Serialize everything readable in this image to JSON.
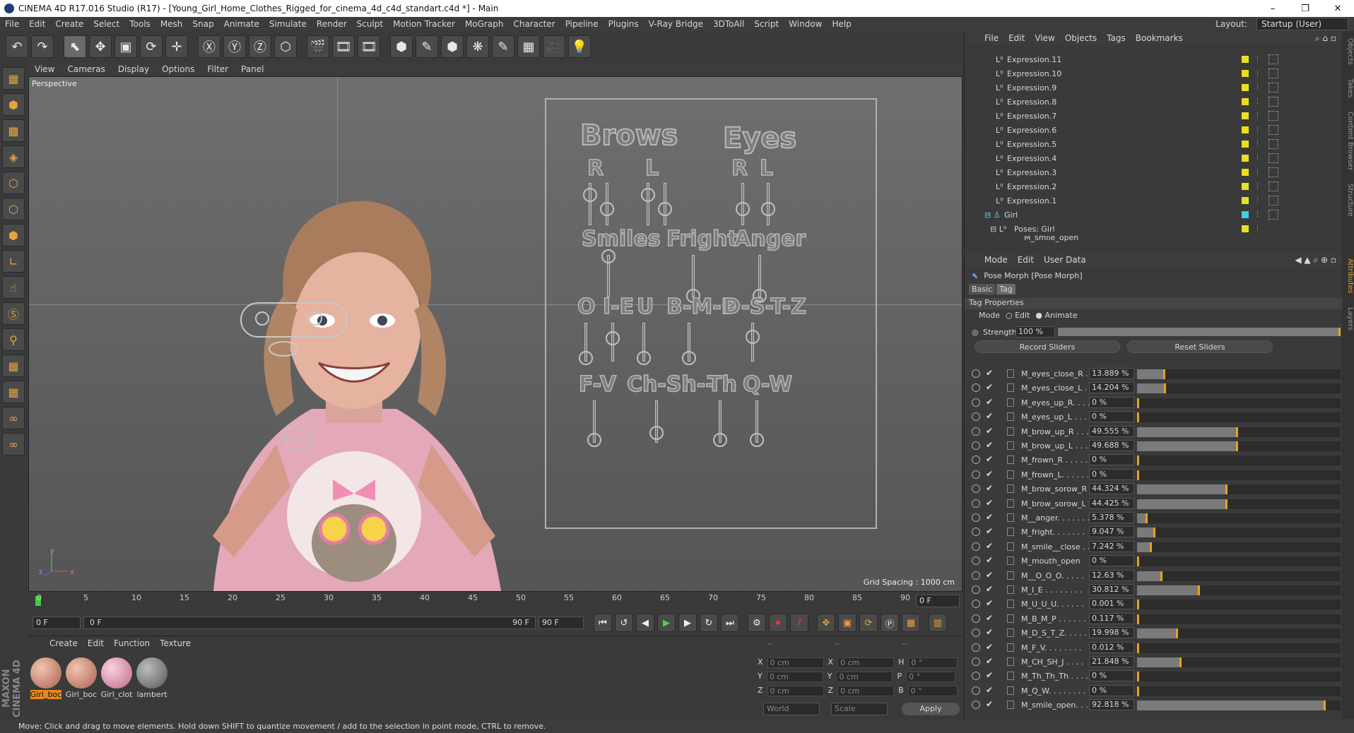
{
  "title": {
    "text": "CINEMA 4D R17.016 Studio (R17) - [Young_Girl_Home_Clothes_Rigged_for_cinema_4d_c4d_standart.c4d *] - Main",
    "min": "–",
    "max": "❐",
    "close": "✕"
  },
  "menubar": {
    "items": [
      "File",
      "Edit",
      "Create",
      "Select",
      "Tools",
      "Mesh",
      "Snap",
      "Animate",
      "Simulate",
      "Render",
      "Sculpt",
      "Motion Tracker",
      "MoGraph",
      "Character",
      "Pipeline",
      "Plugins",
      "V-Ray Bridge",
      "3DToAll",
      "Script",
      "Window",
      "Help"
    ],
    "layout_label": "Layout:",
    "layout_value": "Startup (User)"
  },
  "toolbar": {
    "icons": [
      "↶",
      "↷",
      "⬉",
      "✥",
      "▣",
      "⟳",
      "✛",
      "Ⓧ",
      "Ⓨ",
      "Ⓩ",
      "⬡",
      "🎬",
      "🎞",
      "🎞",
      "⬢",
      "✎",
      "⬢",
      "❋",
      "✎",
      "▦",
      "🎥",
      "💡"
    ]
  },
  "viewport": {
    "menu": [
      "View",
      "Cameras",
      "Display",
      "Options",
      "Filter",
      "Panel"
    ],
    "label": "Perspective",
    "grid_spacing": "Grid Spacing : 1000 cm",
    "axis_y": "y",
    "axis_z": "z",
    "axis_x": "x"
  },
  "rig": {
    "brows": "Brows",
    "eyes": "Eyes",
    "r1": "R",
    "l1": "L",
    "r2": "R",
    "l2": "L",
    "smiles": "Smiles",
    "fright": "Fright",
    "anger": "Anger",
    "o": "O",
    "ie": "I-E",
    "u": "U",
    "bmp": "B-M-P",
    "dstz": "D-S-T-Z",
    "fv": "F-V",
    "chsh": "Ch-Sh--",
    "th": "Th",
    "qw": "Q-W"
  },
  "timeline": {
    "ticks": [
      "0",
      "5",
      "10",
      "15",
      "20",
      "25",
      "30",
      "35",
      "40",
      "45",
      "50",
      "55",
      "60",
      "65",
      "70",
      "75",
      "80",
      "85",
      "90"
    ],
    "end_field": "0 F",
    "start": "0 F",
    "range_start": "0 F",
    "range_end": "90 F",
    "max": "90 F"
  },
  "materials": {
    "menu": [
      "Create",
      "Edit",
      "Function",
      "Texture"
    ],
    "items": [
      "Girl_boc",
      "Girl_boc",
      "Girl_clot",
      "lambert"
    ]
  },
  "coords": {
    "header1": "--",
    "header2": "--",
    "header3": "--",
    "x": "X",
    "y": "Y",
    "z": "Z",
    "x_val": "0 cm",
    "y_val": "0 cm",
    "z_val": "0 cm",
    "x2": "X",
    "y2": "Y",
    "z2": "Z",
    "x2_val": "0 cm",
    "y2_val": "0 cm",
    "z2_val": "0 cm",
    "h": "H",
    "p": "P",
    "b": "B",
    "h_val": "0 °",
    "p_val": "0 °",
    "b_val": "0 °",
    "world": "World",
    "scale": "Scale",
    "apply": "Apply"
  },
  "status": "Move: Click and drag to move elements. Hold down SHIFT to quantize movement / add to the selection in point mode, CTRL to remove.",
  "objmgr": {
    "menu": [
      "File",
      "Edit",
      "View",
      "Objects",
      "Tags",
      "Bookmarks"
    ],
    "rows": [
      "Expression.11",
      "Expression.10",
      "Expression.9",
      "Expression.8",
      "Expression.7",
      "Expression.6",
      "Expression.5",
      "Expression.4",
      "Expression.3",
      "Expression.2",
      "Expression.1",
      "Girl",
      "Poses: Girl",
      "M_smile_open"
    ]
  },
  "attr": {
    "menu": [
      "Mode",
      "Edit",
      "User Data"
    ],
    "title": "Pose Morph [Pose Morph]",
    "tab_basic": "Basic",
    "tab_tag": "Tag",
    "section": "Tag Properties",
    "mode_label": "Mode",
    "mode_edit": "Edit",
    "mode_animate": "Animate",
    "strength_label": "Strength",
    "strength_value": "100 %",
    "record": "Record Sliders",
    "reset": "Reset Sliders",
    "sliders": [
      {
        "name": "M_eyes_close_R . .",
        "value": "13.889 %",
        "pct": 13.889
      },
      {
        "name": "M_eyes_close_L . .",
        "value": "14.204 %",
        "pct": 14.204
      },
      {
        "name": "M_eyes_up_R. . . .",
        "value": "0 %",
        "pct": 0
      },
      {
        "name": "M_eyes_up_L . . . .",
        "value": "0 %",
        "pct": 0
      },
      {
        "name": "M_brow_up_R . . . .",
        "value": "49.555 %",
        "pct": 49.555
      },
      {
        "name": "M_brow_up_L . . . .",
        "value": "49.688 %",
        "pct": 49.688
      },
      {
        "name": "M_frown_R . . . . .",
        "value": "0 %",
        "pct": 0
      },
      {
        "name": "M_frown_L. . . . . .",
        "value": "0 %",
        "pct": 0
      },
      {
        "name": "M_brow_sorow_R",
        "value": "44.324 %",
        "pct": 44.324
      },
      {
        "name": "M_brow_sorow_L",
        "value": "44.425 %",
        "pct": 44.425
      },
      {
        "name": "M__anger. . . . . . .",
        "value": "5.378 %",
        "pct": 5.378
      },
      {
        "name": "M_fright. . . . . . .",
        "value": "9.047 %",
        "pct": 9.047
      },
      {
        "name": "M_smile__close . .",
        "value": "7.242 %",
        "pct": 7.242
      },
      {
        "name": "M_mouth_open",
        "value": "0 %",
        "pct": 0
      },
      {
        "name": "M__O_O_O. . . . .",
        "value": "12.63 %",
        "pct": 12.63
      },
      {
        "name": "M_I_E . . . . . . . .",
        "value": "30.812 %",
        "pct": 30.812
      },
      {
        "name": "M_U_U_U. . . . . .",
        "value": "0.001 %",
        "pct": 0.001
      },
      {
        "name": "M_B_M_P . . . . . .",
        "value": "0.117 %",
        "pct": 0.117
      },
      {
        "name": "M_D_S_T_Z. . . . .",
        "value": "19.998 %",
        "pct": 19.998
      },
      {
        "name": "M_F_V. . . . . . . .",
        "value": "0.012 %",
        "pct": 0.012
      },
      {
        "name": "M_CH_SH_J . . . .",
        "value": "21.848 %",
        "pct": 21.848
      },
      {
        "name": "M_Th_Th_Th . . . .",
        "value": "0 %",
        "pct": 0
      },
      {
        "name": "M_Q_W. . . . . . . .",
        "value": "0 %",
        "pct": 0
      },
      {
        "name": "M_smile_open. . .",
        "value": "92.818 %",
        "pct": 92.818
      }
    ]
  },
  "rightstrip": [
    "Objects",
    "Takes",
    "Content Browser",
    "Structure",
    "Attributes",
    "Layers"
  ]
}
